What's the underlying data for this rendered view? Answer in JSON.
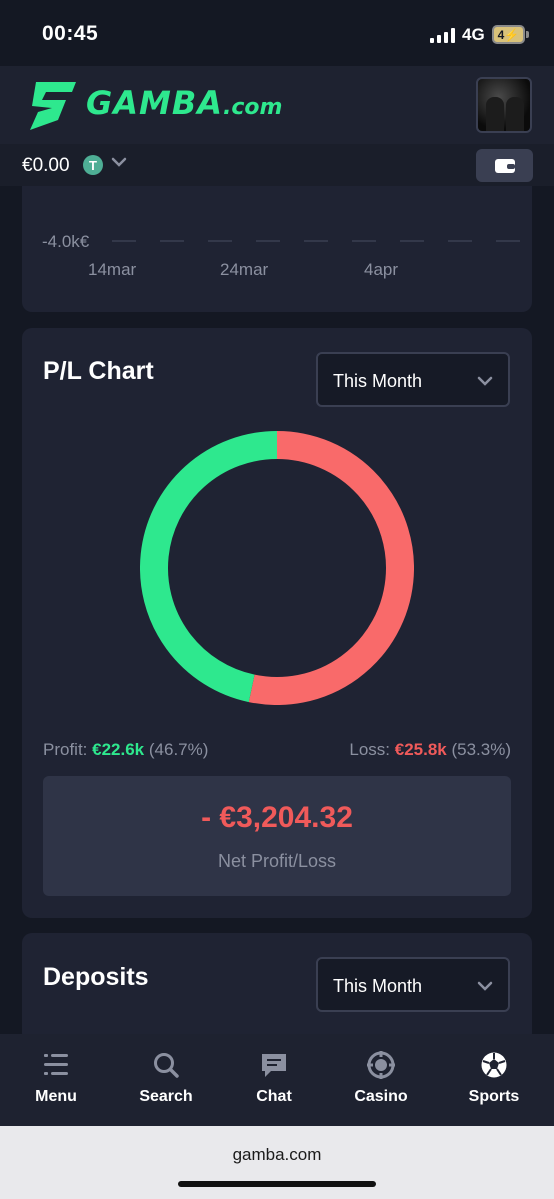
{
  "status_bar": {
    "time": "00:45",
    "network": "4G",
    "battery": "4"
  },
  "header": {
    "logo_text": "GAMBA",
    "logo_suffix": ".com"
  },
  "balance": {
    "amount": "€0.00",
    "currency_symbol": "T"
  },
  "top_chart": {
    "y_tick": "-4.0k€",
    "x_ticks": [
      "14mar",
      "24mar",
      "4apr"
    ]
  },
  "pl_card": {
    "title": "P/L Chart",
    "period": "This Month",
    "profit_label": "Profit:",
    "profit_value": "€22.6k",
    "profit_pct": "(46.7%)",
    "loss_label": "Loss:",
    "loss_value": "€25.8k",
    "loss_pct": "(53.3%)",
    "net_value": "- €3,204.32",
    "net_caption": "Net Profit/Loss"
  },
  "chart_data": {
    "type": "pie",
    "categories": [
      "Profit",
      "Loss"
    ],
    "values": [
      46.7,
      53.3
    ],
    "colors": [
      "#2ee88e",
      "#f96a6a"
    ]
  },
  "deposits_card": {
    "title": "Deposits",
    "period": "This Month"
  },
  "bottom_nav": {
    "items": [
      {
        "label": "Menu",
        "icon": "menu-icon"
      },
      {
        "label": "Search",
        "icon": "search-icon"
      },
      {
        "label": "Chat",
        "icon": "chat-icon"
      },
      {
        "label": "Casino",
        "icon": "casino-chip-icon"
      },
      {
        "label": "Sports",
        "icon": "soccer-ball-icon"
      }
    ]
  },
  "browser": {
    "url": "gamba.com"
  }
}
